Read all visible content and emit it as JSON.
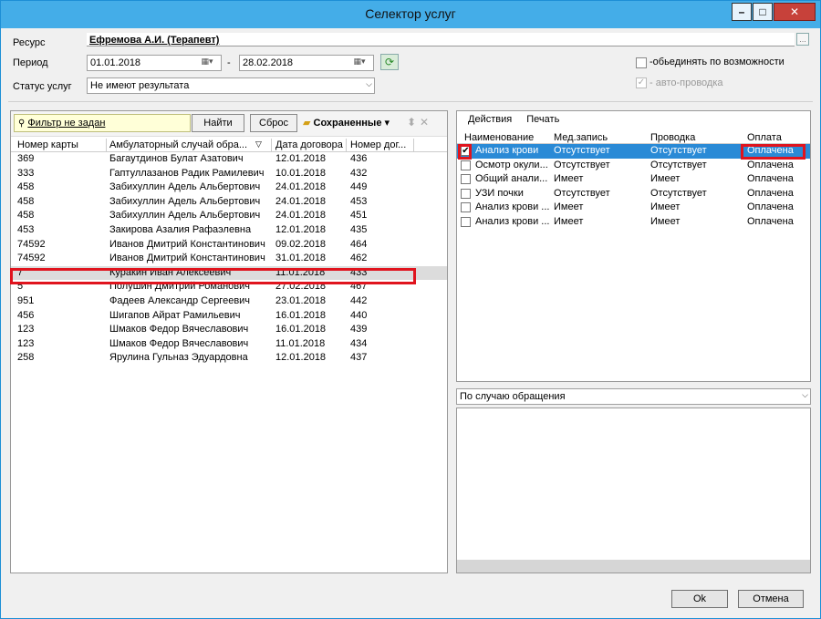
{
  "window": {
    "title": "Селектор услуг"
  },
  "form": {
    "resource_label": "Ресурс",
    "resource_value": "Ефремова А.И. (Терапевт)",
    "period_label": "Период",
    "period_from": "01.01.2018",
    "period_dash": "-",
    "period_to": "28.02.2018",
    "status_label": "Статус услуг",
    "status_value": "Не имеют результата",
    "combine_label": "-обьединять по возможности",
    "autopost_label": "- авто-проводка"
  },
  "toolbar": {
    "filter_text": "Фильтр не задан",
    "find_label": "Найти",
    "reset_label": "Сброс",
    "saved_label": "Сохраненные"
  },
  "left_table": {
    "headers": [
      "Номер карты",
      "Амбулаторный случай обра...",
      "Дата договора",
      "Номер дог..."
    ],
    "rows": [
      [
        "369",
        "Багаутдинов Булат Азатович",
        "12.01.2018",
        "436"
      ],
      [
        "333",
        "Гаптуллазанов Радик Рамилевич",
        "10.01.2018",
        "432"
      ],
      [
        "458",
        "Забихуллин Адель Альбертович",
        "24.01.2018",
        "449"
      ],
      [
        "458",
        "Забихуллин Адель Альбертович",
        "24.01.2018",
        "453"
      ],
      [
        "458",
        "Забихуллин Адель Альбертович",
        "24.01.2018",
        "451"
      ],
      [
        "453",
        "Закирова Азалия Рафаэлевна",
        "12.01.2018",
        "435"
      ],
      [
        "74592",
        "Иванов Дмитрий Константинович",
        "09.02.2018",
        "464"
      ],
      [
        "74592",
        "Иванов Дмитрий Константинович",
        "31.01.2018",
        "462"
      ],
      [
        "7",
        "Куракин Иван Алексеевич",
        "11.01.2018",
        "433"
      ],
      [
        "5",
        "Полушин Дмитрий Романович",
        "27.02.2018",
        "467"
      ],
      [
        "951",
        "Фадеев Александр Сергеевич",
        "23.01.2018",
        "442"
      ],
      [
        "456",
        "Шигапов Айрат Рамильевич",
        "16.01.2018",
        "440"
      ],
      [
        "123",
        "Шмаков Федор Вячеславович",
        "16.01.2018",
        "439"
      ],
      [
        "123",
        "Шмаков Федор Вячеславович",
        "11.01.2018",
        "434"
      ],
      [
        "258",
        "Ярулина Гульназ Эдуардовна",
        "12.01.2018",
        "437"
      ]
    ]
  },
  "right_menu": {
    "actions": "Действия",
    "print": "Печать"
  },
  "right_table": {
    "headers": [
      "Наименование",
      "Мед.запись",
      "Проводка",
      "Оплата"
    ],
    "rows": [
      {
        "checked": true,
        "cells": [
          "Анализ крови",
          "Отсутствует",
          "Отсутствует",
          "Оплачена"
        ]
      },
      {
        "checked": false,
        "cells": [
          "Осмотр окули...",
          "Отсутствует",
          "Отсутствует",
          "Оплачена"
        ]
      },
      {
        "checked": false,
        "cells": [
          "Общий анали...",
          "Имеет",
          "Имеет",
          "Оплачена"
        ]
      },
      {
        "checked": false,
        "cells": [
          "УЗИ почки",
          "Отсутствует",
          "Отсутствует",
          "Оплачена"
        ]
      },
      {
        "checked": false,
        "cells": [
          "Анализ крови ...",
          "Имеет",
          "Имеет",
          "Оплачена"
        ]
      },
      {
        "checked": false,
        "cells": [
          "Анализ крови ...",
          "Имеет",
          "Имеет",
          "Оплачена"
        ]
      }
    ]
  },
  "group_combo": {
    "value": "По случаю обращения"
  },
  "buttons": {
    "ok": "Ok",
    "cancel": "Отмена"
  }
}
